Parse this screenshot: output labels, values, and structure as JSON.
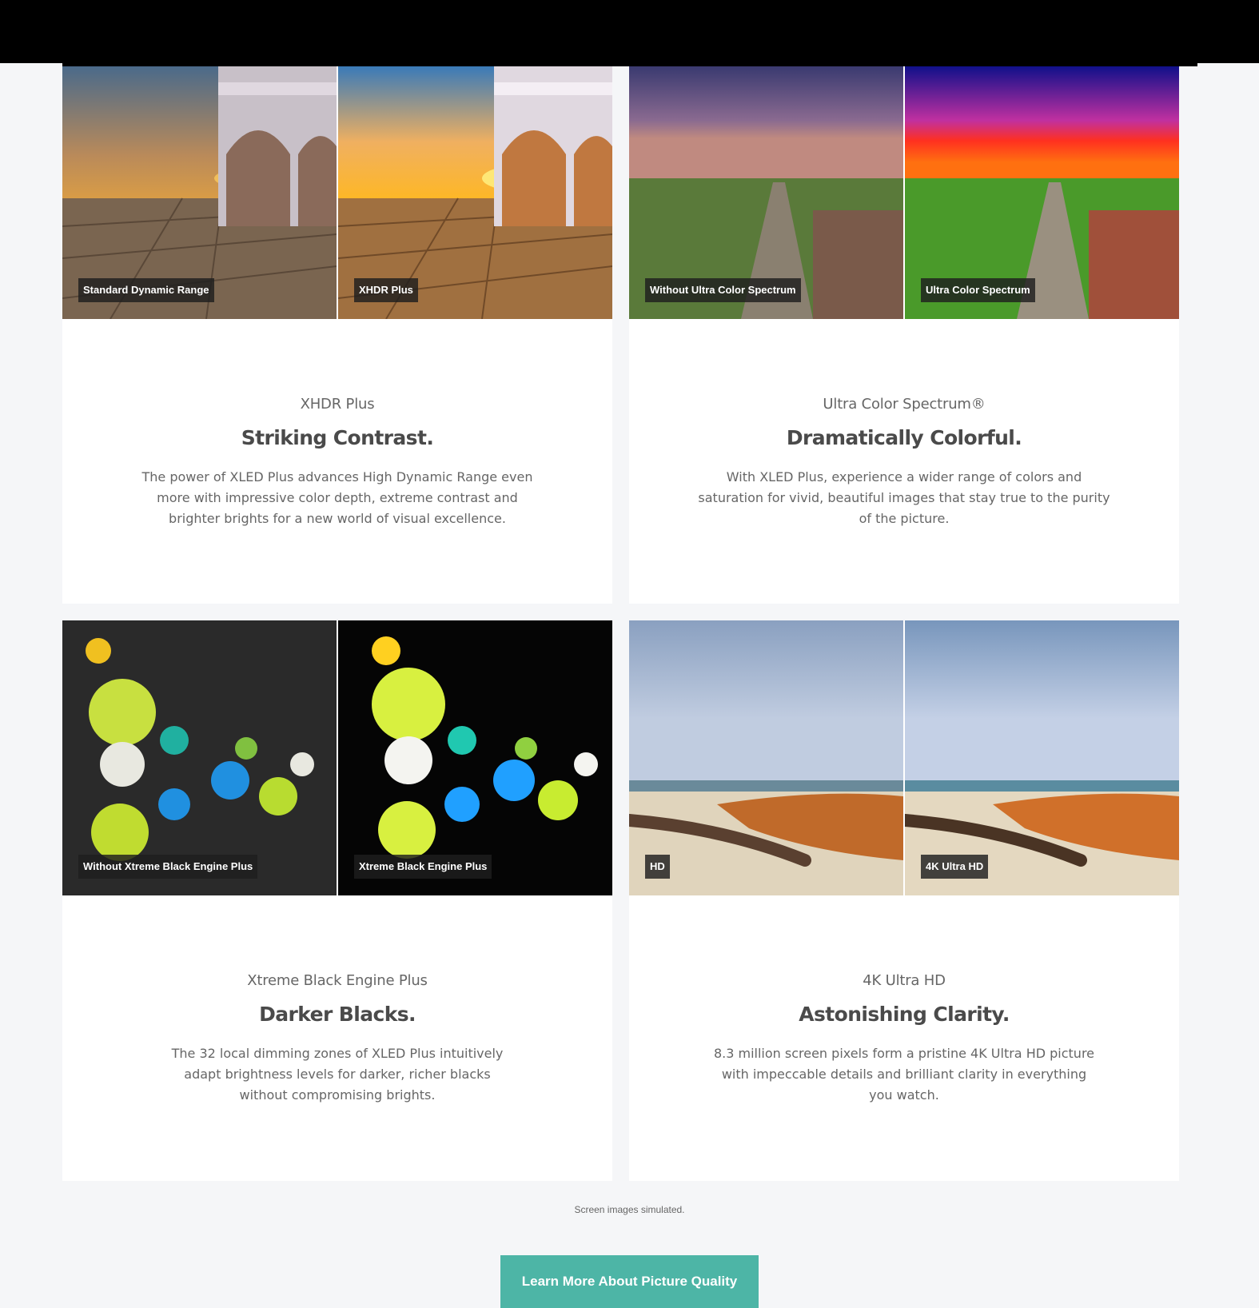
{
  "cards": [
    {
      "left_tag": "Standard Dynamic Range",
      "right_tag": "XHDR Plus",
      "eyebrow": "XHDR Plus",
      "headline": "Striking Contrast.",
      "body": "The power of XLED Plus advances High Dynamic Range even more with impressive color depth, extreme contrast and brighter brights for a new world of visual excellence."
    },
    {
      "left_tag": "Without Ultra Color Spectrum",
      "right_tag": "Ultra Color Spectrum",
      "eyebrow": "Ultra Color Spectrum®",
      "headline": "Dramatically Colorful.",
      "body": "With XLED Plus, experience a wider range of colors and saturation for vivid, beautiful images that stay true to the purity of the picture."
    },
    {
      "left_tag": "Without Xtreme Black Engine Plus",
      "right_tag": "Xtreme Black Engine Plus",
      "eyebrow": "Xtreme Black Engine Plus",
      "headline": "Darker Blacks.",
      "body": "The 32 local dimming zones of XLED Plus intuitively adapt brightness levels for darker, richer blacks without compromising brights."
    },
    {
      "left_tag": "HD",
      "right_tag": "4K Ultra HD",
      "eyebrow": "4K Ultra HD",
      "headline": "Astonishing Clarity.",
      "body": "8.3 million screen pixels form a pristine 4K Ultra HD picture with impeccable details and brilliant clarity in everything you watch."
    }
  ],
  "disclaimer": "Screen images simulated.",
  "cta_label": "Learn More About Picture Quality",
  "colors": {
    "cta": "#4db5a6",
    "page_bg": "#f5f6f8"
  }
}
